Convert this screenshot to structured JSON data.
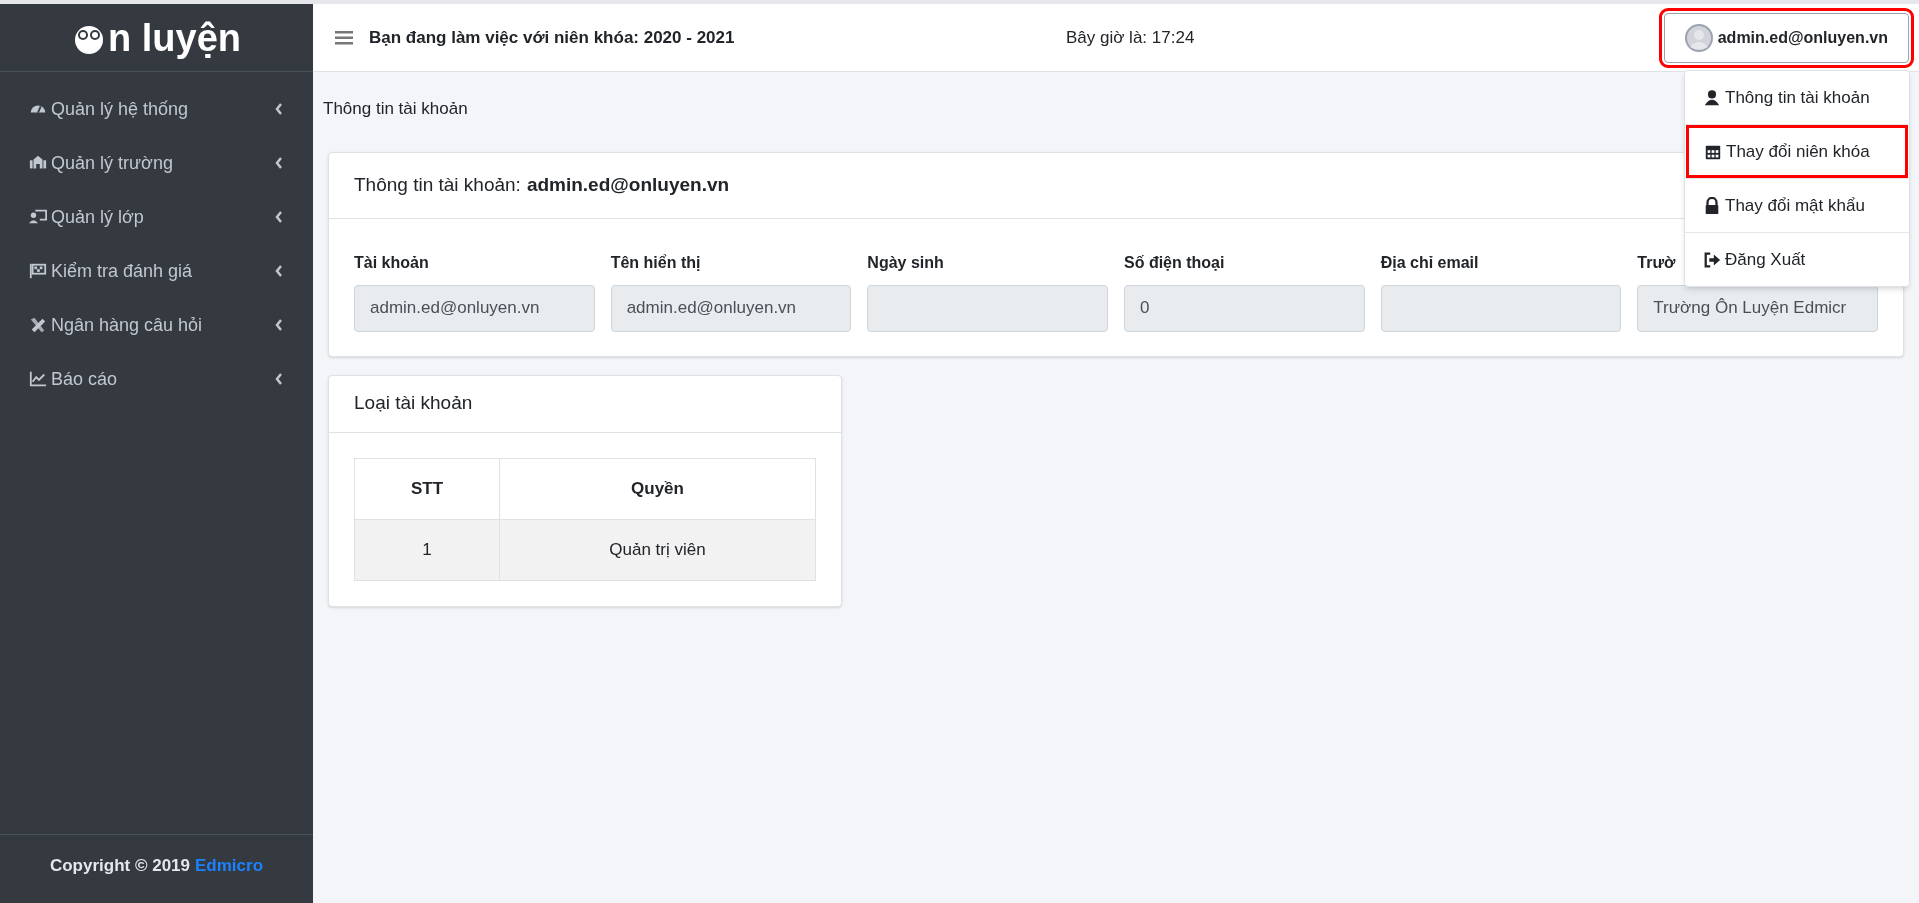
{
  "sidebar": {
    "logo": "n luyện",
    "items": [
      {
        "label": "Quản lý hệ thống",
        "kind": "gauge"
      },
      {
        "label": "Quản lý trường",
        "kind": "school"
      },
      {
        "label": "Quản lý lớp",
        "kind": "teacher"
      },
      {
        "label": "Kiểm tra đánh giá",
        "kind": "flag"
      },
      {
        "label": "Ngân hàng câu hỏi",
        "kind": "tools"
      },
      {
        "label": "Báo cáo",
        "kind": "chart"
      }
    ],
    "footer": {
      "text": "Copyright © 2019",
      "link": "Edmicro"
    }
  },
  "header": {
    "school_year": "Bạn đang làm việc với niên khóa: 2020 - 2021",
    "clock": "Bây giờ là: 17:24",
    "user": {
      "label": "admin.ed@onluyen.vn",
      "highlighted": true
    }
  },
  "user_menu": [
    {
      "label": "Thông tin tài khoản",
      "kind": "user",
      "highlighted": false
    },
    {
      "label": "Thay đổi niên khóa",
      "kind": "calendar",
      "highlighted": true
    },
    {
      "label": "Thay đổi mật khẩu",
      "kind": "lock",
      "highlighted": false
    },
    {
      "label": "Đăng Xuất",
      "kind": "signout",
      "highlighted": false
    }
  ],
  "breadcrumb": "Thông tin tài khoản",
  "account_card": {
    "title": "Thông tin tài khoản:",
    "account": "admin.ed@onluyen.vn",
    "fields": [
      {
        "label": "Tài khoản",
        "value": "admin.ed@onluyen.vn"
      },
      {
        "label": "Tên hiển thị",
        "value": "admin.ed@onluyen.vn"
      },
      {
        "label": "Ngày sinh"
      },
      {
        "label": "Số điện thoại",
        "value": "0"
      },
      {
        "label": "Địa chỉ email"
      },
      {
        "label": "Trườ",
        "value": "Trường Ôn Luyện Edmicr"
      }
    ]
  },
  "role_card": {
    "title": "Loại tài khoản",
    "columns": [
      "STT",
      "Quyền"
    ],
    "rows": [
      [
        "1",
        "Quản trị viên"
      ]
    ]
  }
}
